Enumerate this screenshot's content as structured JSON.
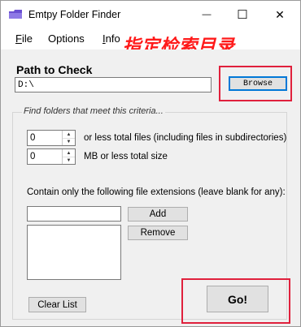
{
  "window": {
    "title": "Emtpy Folder Finder",
    "minimize_glyph": "—",
    "maximize_glyph": "☐",
    "close_glyph": "✕"
  },
  "menu": {
    "file": {
      "first": "F",
      "rest": "ile"
    },
    "options": "Options",
    "info": {
      "first": "I",
      "rest": "nfo"
    }
  },
  "annotation": {
    "text": "指定检索目录",
    "color": "#e0203c"
  },
  "path": {
    "label": "Path to Check",
    "value": "D:\\",
    "browse_label": "Browse"
  },
  "criteria": {
    "legend": "Find folders that meet this criteria...",
    "files": {
      "value": "0",
      "label": "or less total files (including files in subdirectories)"
    },
    "size": {
      "value": "0",
      "label": "MB or less total size"
    },
    "extensions_label": "Contain only the following file extensions (leave blank for any):",
    "extension_input_value": "",
    "add_label": "Add",
    "remove_label": "Remove",
    "clear_label": "Clear List"
  },
  "go_label": "Go!"
}
